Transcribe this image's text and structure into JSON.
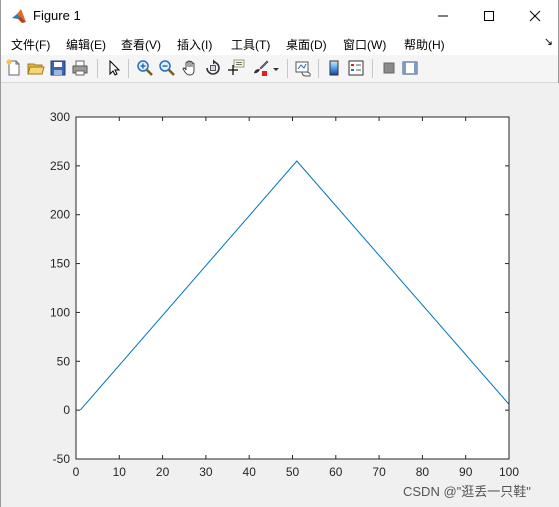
{
  "window": {
    "title": "Figure 1",
    "minimize_symbol": "─",
    "maximize_symbol": "☐",
    "close_symbol": "✕"
  },
  "menu": {
    "items": [
      {
        "label": "文件(F)"
      },
      {
        "label": "编辑(E)"
      },
      {
        "label": "查看(V)"
      },
      {
        "label": "插入(I)"
      },
      {
        "label": "工具(T)"
      },
      {
        "label": "桌面(D)"
      },
      {
        "label": "窗口(W)"
      },
      {
        "label": "帮助(H)"
      }
    ],
    "overflow_arrow": "↘"
  },
  "toolbar": {
    "buttons": [
      {
        "name": "new-figure-icon"
      },
      {
        "name": "open-file-icon"
      },
      {
        "name": "save-figure-icon"
      },
      {
        "name": "print-figure-icon"
      },
      {
        "name": "edit-plot-pointer-icon"
      },
      {
        "name": "zoom-in-icon"
      },
      {
        "name": "zoom-out-icon"
      },
      {
        "name": "pan-hand-icon"
      },
      {
        "name": "rotate-3d-icon"
      },
      {
        "name": "data-cursor-icon"
      },
      {
        "name": "brush-icon"
      },
      {
        "name": "brush-dropdown-icon"
      },
      {
        "name": "link-plot-icon"
      },
      {
        "name": "insert-colorbar-icon"
      },
      {
        "name": "insert-legend-icon"
      },
      {
        "name": "hide-plot-tools-icon"
      },
      {
        "name": "show-plot-tools-icon"
      }
    ]
  },
  "colors": {
    "line": "#0072bd",
    "axes_bg": "#ffffff",
    "figure_bg": "#f0f0f0"
  },
  "chart_data": {
    "type": "line",
    "title": "",
    "xlabel": "",
    "ylabel": "",
    "xlim": [
      0,
      100
    ],
    "ylim": [
      -50,
      300
    ],
    "xticks": [
      "0",
      "10",
      "20",
      "30",
      "40",
      "50",
      "60",
      "70",
      "80",
      "90",
      "100"
    ],
    "yticks": [
      "-50",
      "0",
      "50",
      "100",
      "150",
      "200",
      "250",
      "300"
    ],
    "grid": false,
    "series": [
      {
        "x": [
          1,
          51,
          100
        ],
        "y": [
          0,
          255,
          6
        ]
      }
    ]
  },
  "watermark": "CSDN @\"逛丢一只鞋\""
}
